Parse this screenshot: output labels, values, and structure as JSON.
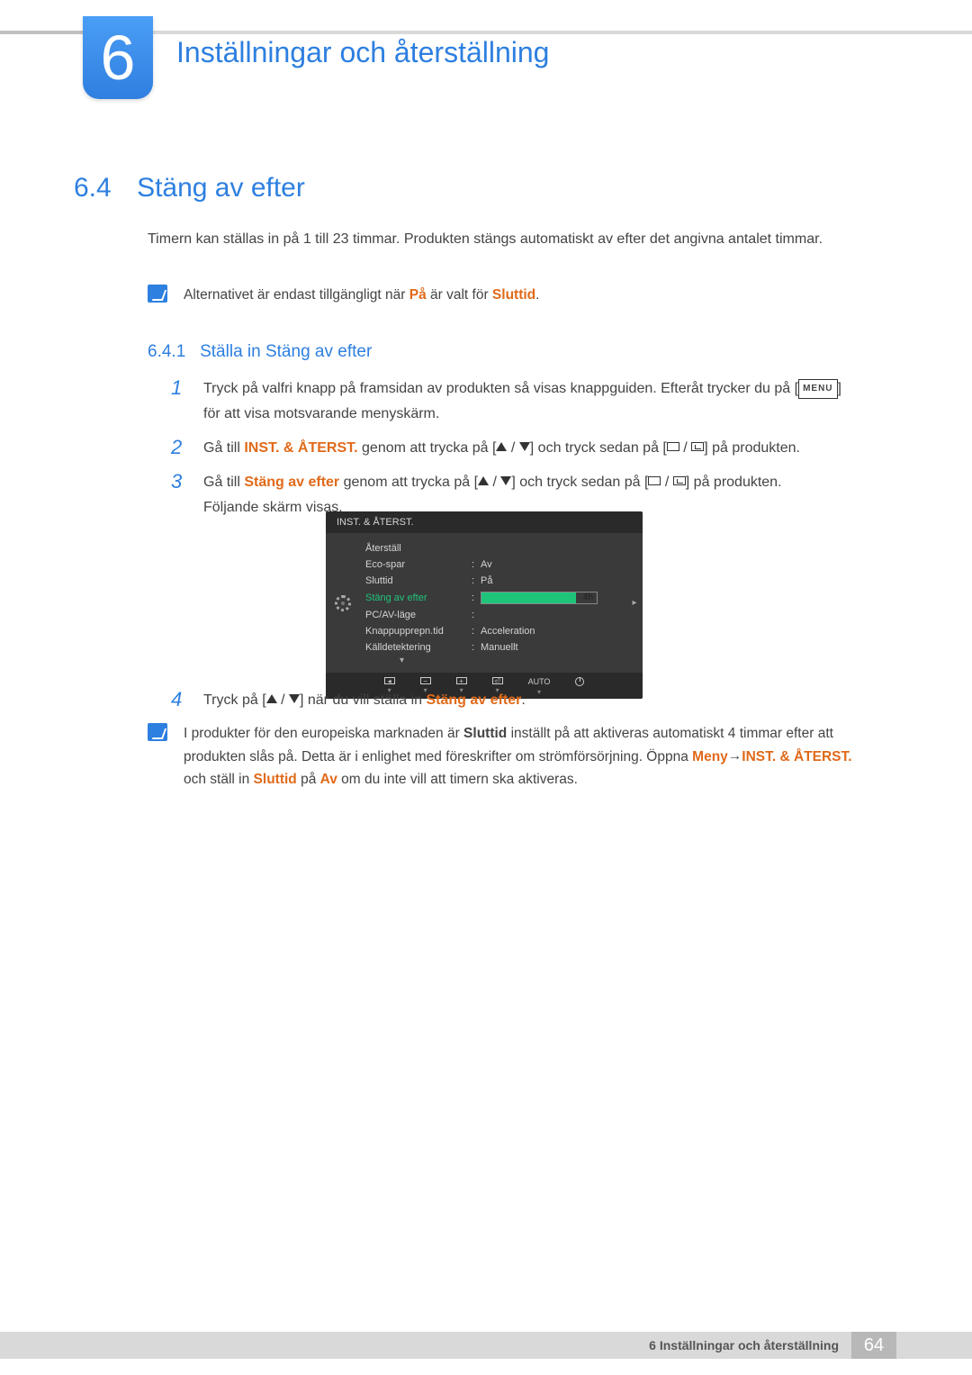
{
  "chapter": {
    "number": "6",
    "title": "Inställningar och återställning"
  },
  "section": {
    "number": "6.4",
    "title": "Stäng av efter"
  },
  "intro": "Timern kan ställas in på 1 till 23 timmar. Produkten stängs automatiskt av efter det angivna antalet timmar.",
  "note1": {
    "prefix": "Alternativet är endast tillgängligt när ",
    "hl1": "På",
    "mid": " är valt för ",
    "hl2": "Sluttid",
    "suffix": "."
  },
  "sub": {
    "number": "6.4.1",
    "title": "Ställa in Stäng av efter"
  },
  "steps": {
    "s1a": "Tryck på valfri knapp på framsidan av produkten så visas knappguiden. Efteråt trycker du på [",
    "s1menu": "MENU",
    "s1b": "] för att visa motsvarande menyskärm.",
    "s2a": "Gå till ",
    "s2hl": "INST. & ÅTERST.",
    "s2b": " genom att trycka på [",
    "s2c": "] och tryck sedan på [",
    "s2d": "] på produkten.",
    "s3a": "Gå till ",
    "s3hl": "Stäng av efter",
    "s3b": " genom att trycka på [",
    "s3c": "] och tryck sedan på [",
    "s3d": "] på produkten.",
    "s3e": "Följande skärm visas.",
    "s4a": "Tryck på [",
    "s4b": "] när du vill ställa in ",
    "s4hl": "Stäng av efter",
    "s4c": "."
  },
  "osd": {
    "title": "INST. & ÅTERST.",
    "rows": [
      {
        "label": "Återställ",
        "val": ""
      },
      {
        "label": "Eco-spar",
        "val": "Av"
      },
      {
        "label": "Sluttid",
        "val": "På"
      },
      {
        "label": "Stäng av efter",
        "val": "4h",
        "active": true
      },
      {
        "label": "PC/AV-läge",
        "val": ""
      },
      {
        "label": "Knappupprepn.tid",
        "val": "Acceleration"
      },
      {
        "label": "Källdetektering",
        "val": "Manuellt"
      }
    ],
    "footer_auto": "AUTO"
  },
  "note2": {
    "a": "I produkter för den europeiska marknaden är ",
    "b_bold": "Sluttid",
    "c": " inställt på att aktiveras automatiskt 4 timmar efter att produkten slås på. Detta är i enlighet med föreskrifter om strömförsörjning. Öppna ",
    "d_hl": "Meny",
    "arrow": " → ",
    "e_hl": "INST. & ÅTERST.",
    "f": " och ställ in ",
    "g_hl": "Sluttid",
    "h": " på ",
    "i_hl": "Av",
    "j": " om du inte vill att timern ska aktiveras."
  },
  "footer": {
    "label": "6 Inställningar och återställning",
    "page": "64"
  }
}
